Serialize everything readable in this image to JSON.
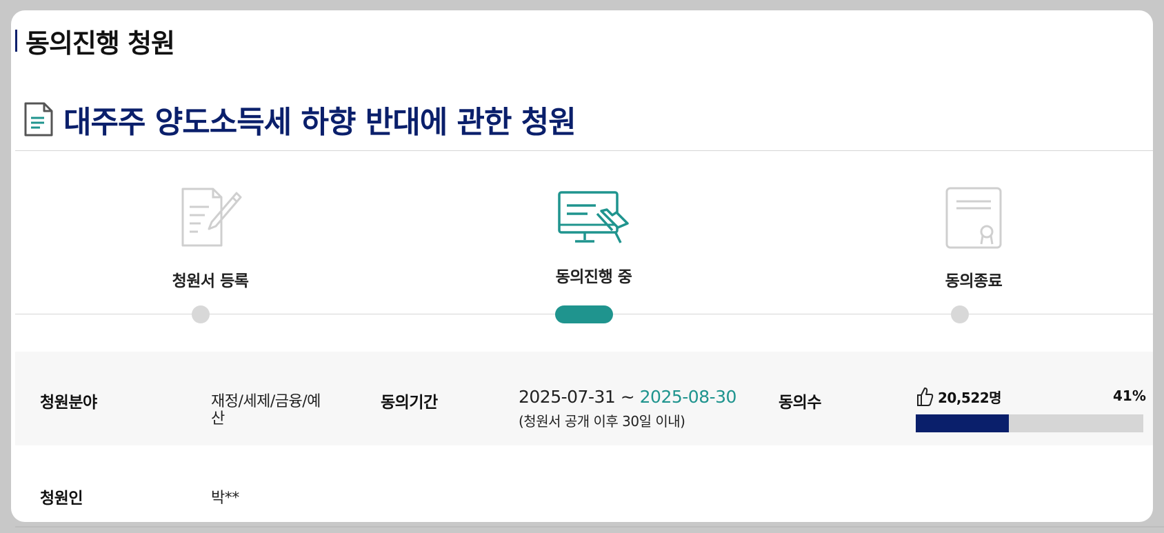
{
  "section": {
    "title": "동의진행 청원"
  },
  "petition": {
    "title": "대주주 양도소득세 하향 반대에 관한 청원"
  },
  "steps": [
    {
      "label": "청원서 등록",
      "icon": "document-pencil-icon",
      "state": "done"
    },
    {
      "label": "동의진행 중",
      "icon": "monitor-click-icon",
      "state": "active"
    },
    {
      "label": "동의종료",
      "icon": "certificate-icon",
      "state": "pending"
    }
  ],
  "info": {
    "category_label": "청원분야",
    "category_value_line1": "재정/세제/금융/예",
    "category_value_line2": "산",
    "period_label": "동의기간",
    "period_start": "2025-07-31",
    "period_separator": " ~ ",
    "period_end": "2025-08-30",
    "period_note": "(청원서 공개 이후 30일 이내)",
    "count_label": "동의수",
    "count_value": "20,522명",
    "percent_text": "41%",
    "percent_fraction": 0.41,
    "petitioner_label": "청원인",
    "petitioner_value": "박**"
  },
  "colors": {
    "navy": "#0a1f6b",
    "teal": "#1f948e",
    "inactive": "#d8d8d8"
  }
}
